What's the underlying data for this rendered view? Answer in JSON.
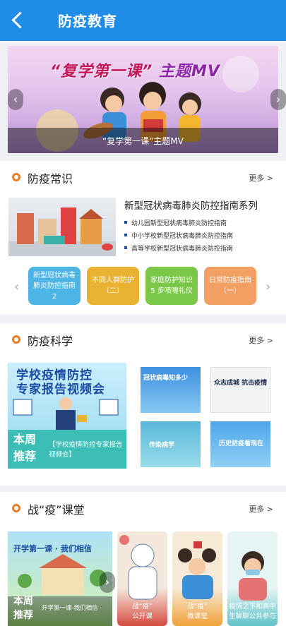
{
  "header": {
    "title": "防疫教育"
  },
  "banner": {
    "title_part1": "“复学第一课”",
    "title_part2": "主题MV",
    "caption": "“复学第一课”主题MV"
  },
  "sections": {
    "knowledge": {
      "title": "防疫常识",
      "more": "更多 >"
    },
    "science": {
      "title": "防疫科学",
      "more": "更多 >"
    },
    "classroom": {
      "title": "战“疫”课堂",
      "more": "更多 >"
    }
  },
  "knowledge": {
    "main_title": "新型冠状病毒肺炎防控指南系列",
    "items": [
      "幼儿园新型冠状病毒肺炎防控指南",
      "中小学校新型冠状病毒肺炎防控指南",
      "高等学校新型冠状病毒肺炎防控指南"
    ],
    "tags": [
      {
        "label": "新型冠状病毒肺炎防控指南2",
        "color": "#4db4e6"
      },
      {
        "label": "不同人群防护（二）",
        "color": "#e9b233"
      },
      {
        "label": "家庭防护知识5 步喷嚏礼仪",
        "color": "#7bc74a"
      },
      {
        "label": "日常防疫指南（一）",
        "color": "#f29f63"
      }
    ]
  },
  "science": {
    "big_title_line1": "学校疫情防控",
    "big_title_line2": "专家报告视频会",
    "week_label_1": "本周",
    "week_label_2": "推荐",
    "week_desc": "【学校疫情防控专家报告视频会】",
    "thumbs": [
      {
        "text": "冠状病毒知多少"
      },
      {
        "text": "众志成城 抗击疫情"
      },
      {
        "text": "传染病学"
      },
      {
        "text": "历史防疫看现在"
      }
    ]
  },
  "classroom": {
    "big_title": "开学第一课 · 我们相信",
    "week_label_1": "本周",
    "week_label_2": "推荐",
    "week_desc": "开学第一课-我们相信",
    "cards": [
      {
        "label_1": "战“疫”",
        "label_2": "公开课",
        "color": "#d64a3e"
      },
      {
        "label_1": "战“疫”",
        "label_2": "微课堂",
        "color": "#f0a23a"
      },
      {
        "label_1": "疫情之下和高中",
        "label_2": "生聊聊公共参与",
        "color": "#5fc2c8"
      }
    ]
  },
  "colors": {
    "header": "#1f8ce8",
    "accent": "#f07c28"
  },
  "icons": {
    "back": "chevron-left-icon",
    "prev": "chevron-left-icon",
    "next": "chevron-right-icon"
  }
}
